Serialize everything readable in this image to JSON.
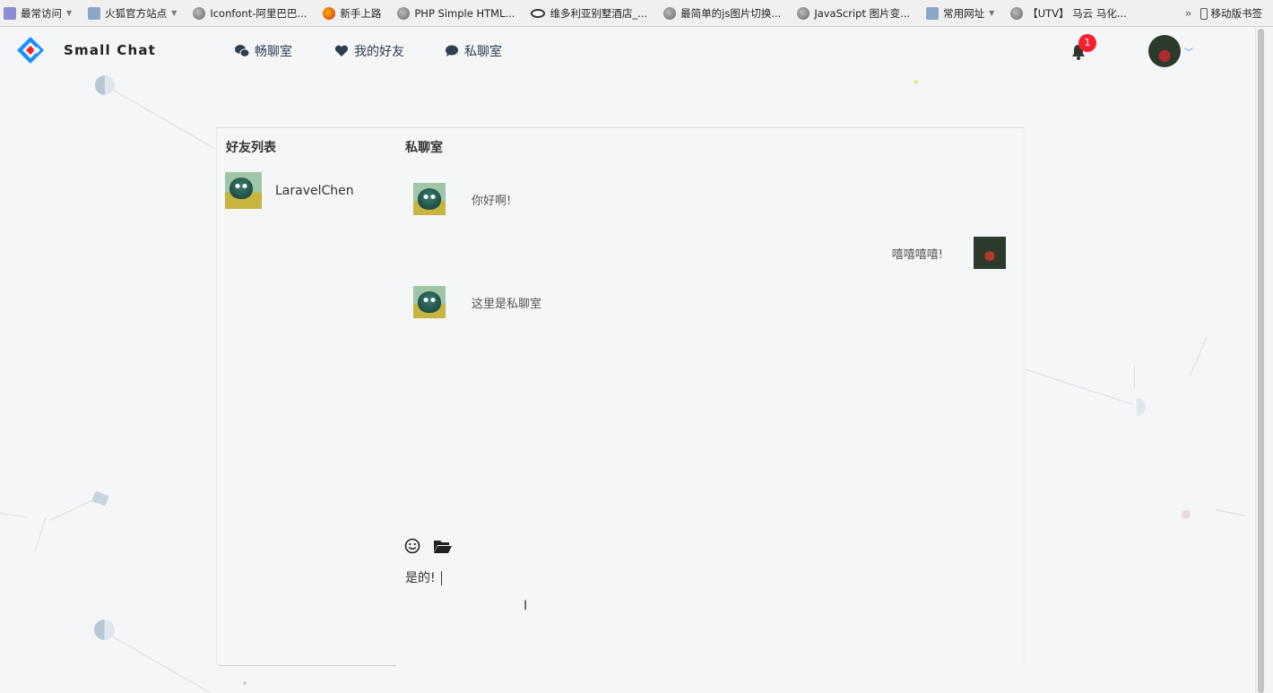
{
  "bookmarks": {
    "items": [
      {
        "label": "最常访问",
        "icon": "app-icon",
        "dropdown": true
      },
      {
        "label": "火狐官方站点",
        "icon": "folder-icon",
        "dropdown": true
      },
      {
        "label": "Iconfont-阿里巴巴...",
        "icon": "globe-icon",
        "dropdown": false
      },
      {
        "label": "新手上路",
        "icon": "firefox-icon",
        "dropdown": false
      },
      {
        "label": "PHP Simple HTML...",
        "icon": "globe-icon",
        "dropdown": false
      },
      {
        "label": "维多利亚别墅酒店_...",
        "icon": "tripadvisor-icon",
        "dropdown": false
      },
      {
        "label": "最简单的js图片切换...",
        "icon": "globe-icon",
        "dropdown": false
      },
      {
        "label": "JavaScript 图片变...",
        "icon": "globe-icon",
        "dropdown": false
      },
      {
        "label": "常用网址",
        "icon": "folder-icon",
        "dropdown": true
      },
      {
        "label": "【UTV】 马云 马化...",
        "icon": "globe-icon",
        "dropdown": false
      }
    ],
    "mobile_label": "移动版书签"
  },
  "nav": {
    "brand": "Small Chat",
    "items": [
      {
        "label": "畅聊室",
        "icon": "wechat-icon"
      },
      {
        "label": "我的好友",
        "icon": "heart-icon"
      },
      {
        "label": "私聊室",
        "icon": "comment-icon"
      }
    ],
    "notification_count": "1"
  },
  "friends": {
    "title": "好友列表",
    "list": [
      {
        "name": "LaravelChen"
      }
    ]
  },
  "chat": {
    "title": "私聊室",
    "messages": [
      {
        "side": "left",
        "text": "你好啊!"
      },
      {
        "side": "right",
        "text": "嘻嘻嘻嘻!"
      },
      {
        "side": "left",
        "text": "这里是私聊室"
      }
    ],
    "draft": "是的!",
    "colors": {
      "accent": "#1890ff",
      "badge": "#f5222d"
    }
  }
}
